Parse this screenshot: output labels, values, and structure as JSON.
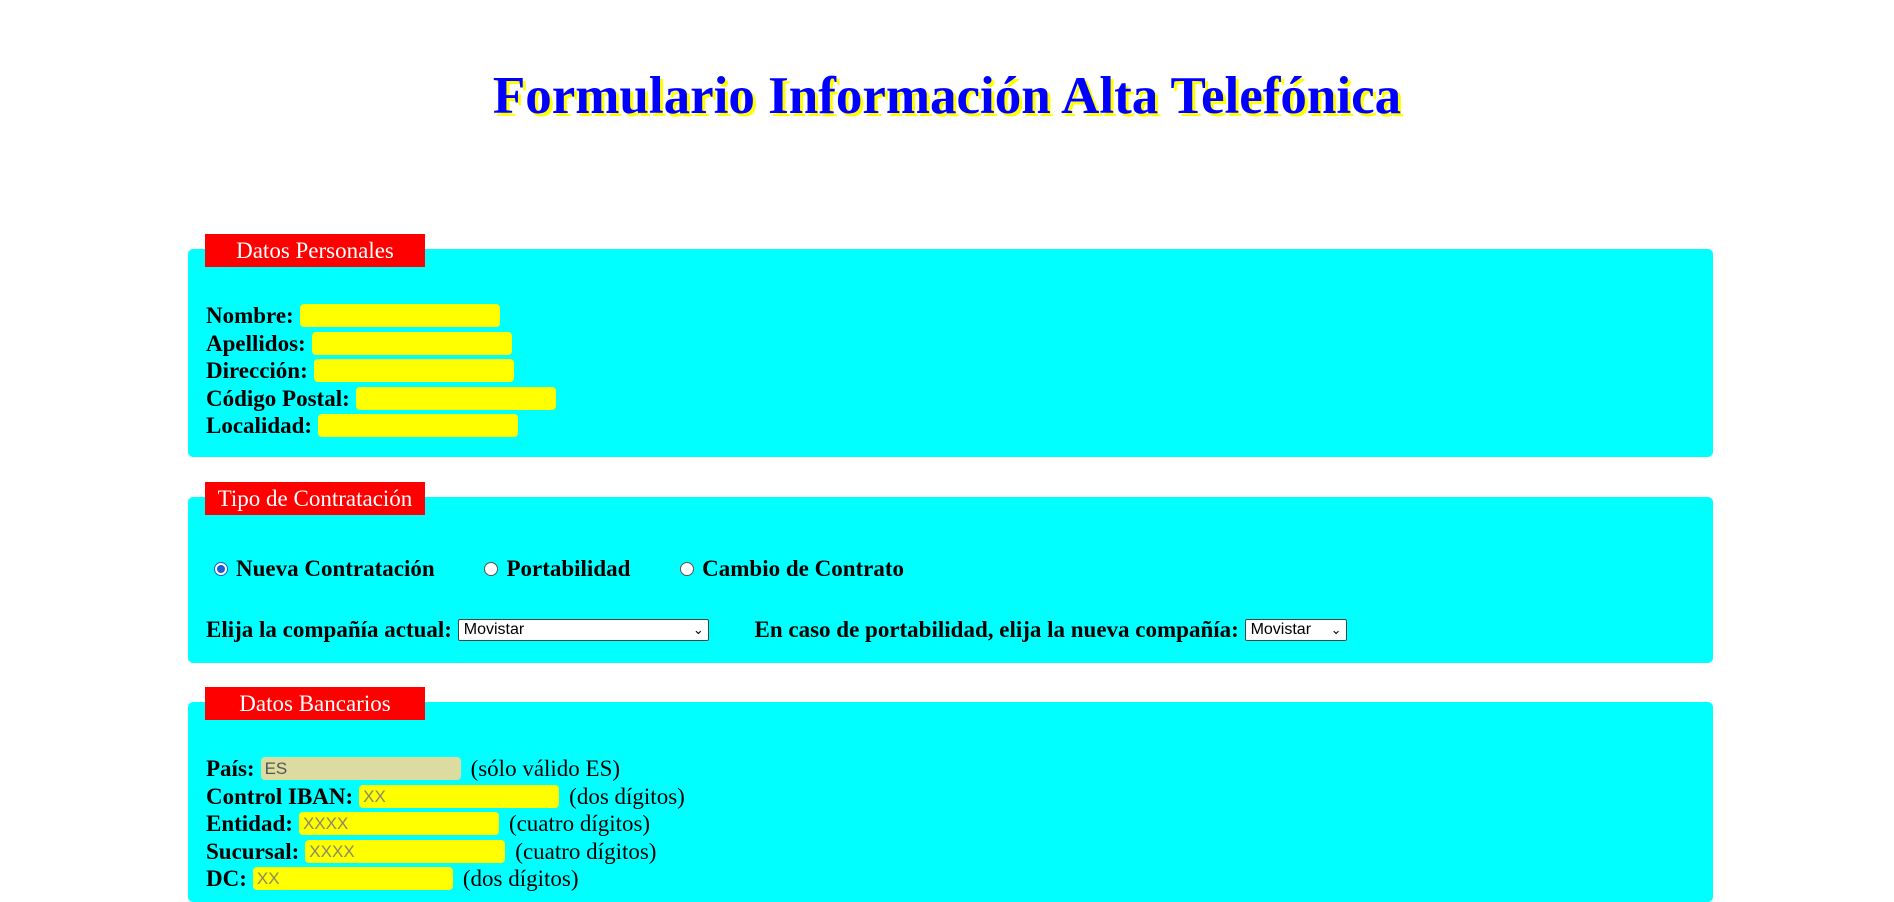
{
  "title": "Formulario Información Alta Telefónica",
  "personal": {
    "legend": "Datos Personales",
    "fields": [
      {
        "label": "Nombre:",
        "value": ""
      },
      {
        "label": "Apellidos:",
        "value": ""
      },
      {
        "label": "Dirección:",
        "value": ""
      },
      {
        "label": "Código Postal:",
        "value": ""
      },
      {
        "label": "Localidad:",
        "value": ""
      }
    ]
  },
  "contract": {
    "legend": "Tipo de Contratación",
    "options": [
      {
        "label": "Nueva Contratación",
        "checked": true
      },
      {
        "label": "Portabilidad",
        "checked": false
      },
      {
        "label": "Cambio de Contrato",
        "checked": false
      }
    ],
    "current_label": "Elija la compañía actual:",
    "current_value": "Movistar",
    "new_label": "En caso de portabilidad, elija la nueva compañía:",
    "new_value": "Movistar"
  },
  "bank": {
    "legend": "Datos Bancarios",
    "fields": [
      {
        "label": "País:",
        "placeholder": "ES",
        "note": "(sólo válido ES)"
      },
      {
        "label": "Control IBAN:",
        "placeholder": "XX",
        "note": "(dos dígitos)"
      },
      {
        "label": "Entidad:",
        "placeholder": "XXXX",
        "note": "(cuatro dígitos)"
      },
      {
        "label": "Sucursal:",
        "placeholder": "XXXX",
        "note": "(cuatro dígitos)"
      },
      {
        "label": "DC:",
        "placeholder": "XX",
        "note": "(dos dígitos)"
      }
    ]
  },
  "colors": {
    "title": "#0000ff",
    "title_shadow": "#ffff00",
    "section_bg": "#00ffff",
    "legend_bg": "#ff0000",
    "input_bg": "#ffff00"
  }
}
